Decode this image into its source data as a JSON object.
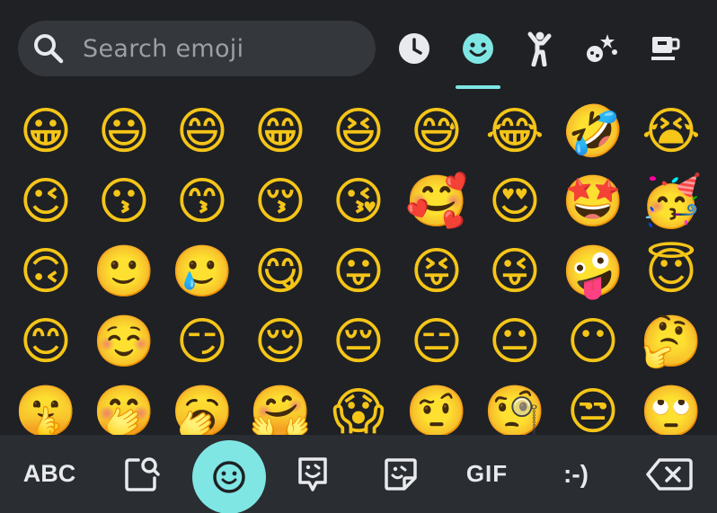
{
  "search": {
    "placeholder": "Search emoji"
  },
  "categories": [
    "clock-icon",
    "smiley-icon",
    "person-icon",
    "celebration-icon",
    "coffee-icon"
  ],
  "grid": {
    "rows": [
      [
        "😀",
        "😃",
        "😄",
        "😁",
        "😆",
        "😅",
        "😂",
        "🤣",
        "😭"
      ],
      [
        "😉",
        "😗",
        "😙",
        "😚",
        "😘",
        "🥰",
        "😍",
        "🤩",
        "🥳"
      ],
      [
        "🙃",
        "🙂",
        "🥲",
        "😋",
        "😛",
        "😝",
        "😜",
        "🤪",
        "😇"
      ],
      [
        "😊",
        "☺️",
        "😏",
        "😌",
        "😔",
        "😑",
        "😐",
        "😶",
        "🤔"
      ],
      [
        "🤫",
        "🤭",
        "🥱",
        "🤗",
        "😱",
        "🤨",
        "🧐",
        "😒",
        "🙄"
      ]
    ]
  },
  "bottom": {
    "abc_label": "ABC",
    "gif_label": "GIF",
    "emoticon_label": ":-)"
  },
  "colors": {
    "background": "#1f2124",
    "search_bg": "#34373b",
    "accent": "#7fe6e4",
    "bottom_bar": "#2a2d31"
  }
}
